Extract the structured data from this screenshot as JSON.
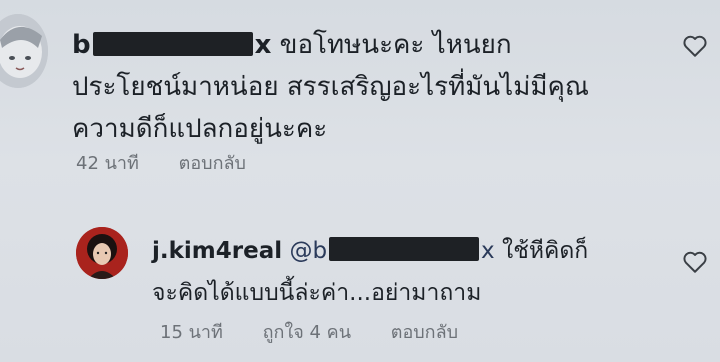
{
  "comments": [
    {
      "username_prefix": "b",
      "username_suffix": "x",
      "text_line1": "ขอโทษนะคะ ไหนยก",
      "text_line2": "ประโยชน์มาหน่อย สรรเสริญอะไรที่มันไม่มีคุณ",
      "text_line3": "ความดีก็แปลกอยู่นะคะ",
      "time": "42 นาที",
      "reply_label": "ตอบกลับ"
    },
    {
      "username": "j.kim4real",
      "mention_prefix": "@b",
      "mention_suffix": "x",
      "text_line1": "ใช้หีคิดก็",
      "text_line2": "จะคิดได้แบบนี้ล่ะค่า...อย่ามาถาม",
      "time": "15 นาที",
      "likes": "ถูกใจ 4 คน",
      "reply_label": "ตอบกลับ"
    }
  ],
  "icons": {
    "like": "heart-outline-icon"
  }
}
